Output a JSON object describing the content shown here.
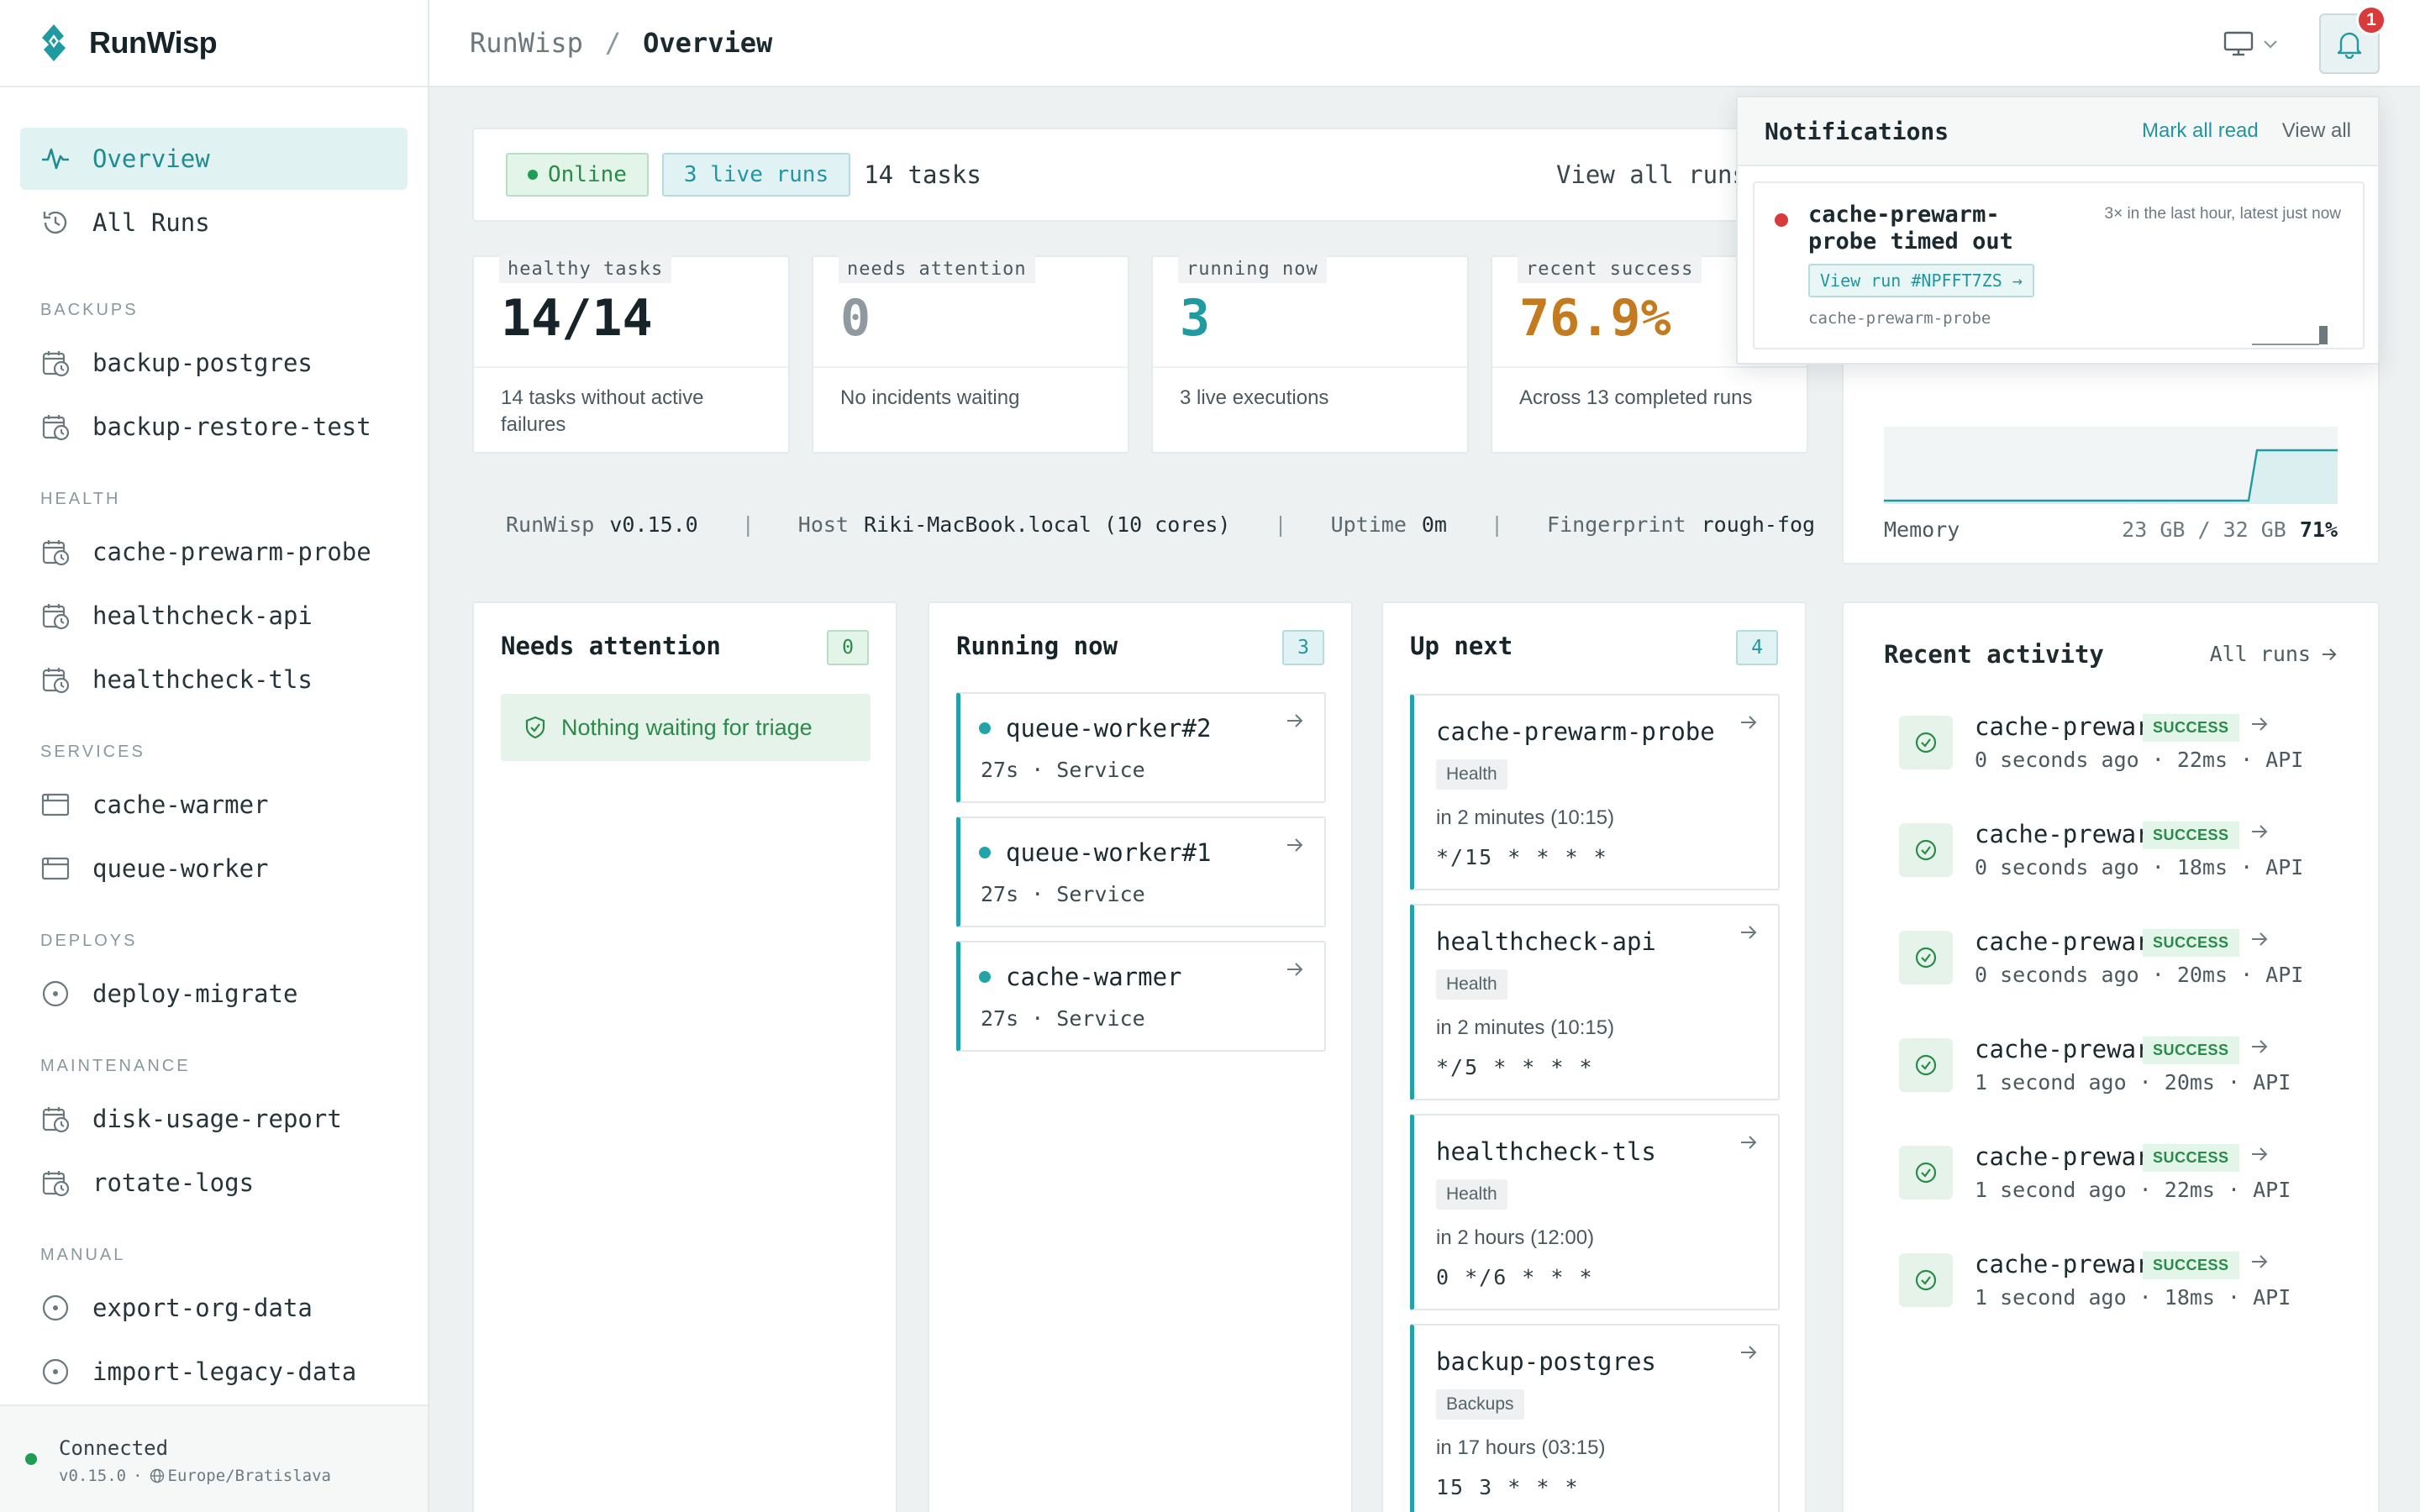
{
  "brand": {
    "name": "RunWisp"
  },
  "sidebar": {
    "primary": [
      {
        "label": "Overview",
        "icon": "activity-icon",
        "active": true
      },
      {
        "label": "All Runs",
        "icon": "history-icon",
        "active": false
      }
    ],
    "sections": [
      {
        "title": "BACKUPS",
        "items": [
          "backup-postgres",
          "backup-restore-test"
        ],
        "icon": "calendar-clock-icon"
      },
      {
        "title": "HEALTH",
        "items": [
          "cache-prewarm-probe",
          "healthcheck-api",
          "healthcheck-tls"
        ],
        "icon": "calendar-clock-icon"
      },
      {
        "title": "SERVICES",
        "items": [
          "cache-warmer",
          "queue-worker"
        ],
        "icon": "window-icon"
      },
      {
        "title": "DEPLOYS",
        "items": [
          "deploy-migrate"
        ],
        "icon": "circle-dot-icon"
      },
      {
        "title": "MAINTENANCE",
        "items": [
          "disk-usage-report",
          "rotate-logs"
        ],
        "icon": "calendar-clock-icon"
      },
      {
        "title": "MANUAL",
        "items": [
          "export-org-data",
          "import-legacy-data"
        ],
        "icon": "circle-dot-icon"
      }
    ],
    "footer": {
      "status": "Connected",
      "version": "v0.15.0",
      "timezone": "Europe/Bratislava"
    }
  },
  "topbar": {
    "crumb_root": "RunWisp",
    "crumb_sep": "/",
    "crumb_current": "Overview",
    "notification_count": "1"
  },
  "status": {
    "online": "Online",
    "live_runs": "3 live runs",
    "tasks": "14 tasks",
    "view_all": "View all runs"
  },
  "stats": [
    {
      "tag": "healthy tasks",
      "value": "14/14",
      "desc": "14 tasks without active failures",
      "color": "#16242a"
    },
    {
      "tag": "needs attention",
      "value": "0",
      "desc": "No incidents waiting",
      "color": "#8e9a9f"
    },
    {
      "tag": "running now",
      "value": "3",
      "desc": "3 live executions",
      "color": "#1f9aa0"
    },
    {
      "tag": "recent success",
      "value": "76.9%",
      "desc": "Across 13 completed runs",
      "color": "#c47a1e"
    }
  ],
  "sysinfo": {
    "app_label": "RunWisp",
    "app_version": "v0.15.0",
    "host_label": "Host",
    "host_value": "Riki-MacBook.local (10 cores)",
    "uptime_label": "Uptime",
    "uptime_value": "0m",
    "fp_label": "Fingerprint",
    "fp_value": "rough-fog",
    "sep": "|"
  },
  "resources": {
    "memory_label": "Memory",
    "memory_used": "23 GB / 32 GB",
    "memory_pct": "71%",
    "memory_fraction": 0.71
  },
  "needs_attention": {
    "title": "Needs attention",
    "count": "0",
    "empty": "Nothing waiting for triage"
  },
  "running_now": {
    "title": "Running now",
    "count": "3",
    "items": [
      {
        "name": "queue-worker#2",
        "meta": "27s · Service"
      },
      {
        "name": "queue-worker#1",
        "meta": "27s · Service"
      },
      {
        "name": "cache-warmer",
        "meta": "27s · Service"
      }
    ]
  },
  "up_next": {
    "title": "Up next",
    "count": "4",
    "items": [
      {
        "name": "cache-prewarm-probe",
        "tag": "Health",
        "when": "in 2 minutes (10:15)",
        "cron": "*/15 * * * *"
      },
      {
        "name": "healthcheck-api",
        "tag": "Health",
        "when": "in 2 minutes (10:15)",
        "cron": "*/5 * * * *"
      },
      {
        "name": "healthcheck-tls",
        "tag": "Health",
        "when": "in 2 hours (12:00)",
        "cron": "0 */6 * * *"
      },
      {
        "name": "backup-postgres",
        "tag": "Backups",
        "when": "in 17 hours (03:15)",
        "cron": "15 3 * * *"
      }
    ]
  },
  "activity": {
    "title": "Recent activity",
    "all_runs": "All runs",
    "items": [
      {
        "name": "cache-prewarm…",
        "status": "SUCCESS",
        "meta": "0 seconds ago · 22ms · API"
      },
      {
        "name": "cache-prewarm…",
        "status": "SUCCESS",
        "meta": "0 seconds ago · 18ms · API"
      },
      {
        "name": "cache-prewarm…",
        "status": "SUCCESS",
        "meta": "0 seconds ago · 20ms · API"
      },
      {
        "name": "cache-prewarm…",
        "status": "SUCCESS",
        "meta": "1 second ago · 20ms · API"
      },
      {
        "name": "cache-prewarm…",
        "status": "SUCCESS",
        "meta": "1 second ago · 22ms · API"
      },
      {
        "name": "cache-prewarm…",
        "status": "SUCCESS",
        "meta": "1 second ago · 18ms · API"
      }
    ]
  },
  "notifications": {
    "title": "Notifications",
    "mark_all": "Mark all read",
    "view_all": "View all",
    "item": {
      "message": "cache-prewarm-probe timed out",
      "when": "3× in the last hour, latest just now",
      "link": "View run #NPFFT7ZS →",
      "source": "cache-prewarm-probe"
    }
  }
}
